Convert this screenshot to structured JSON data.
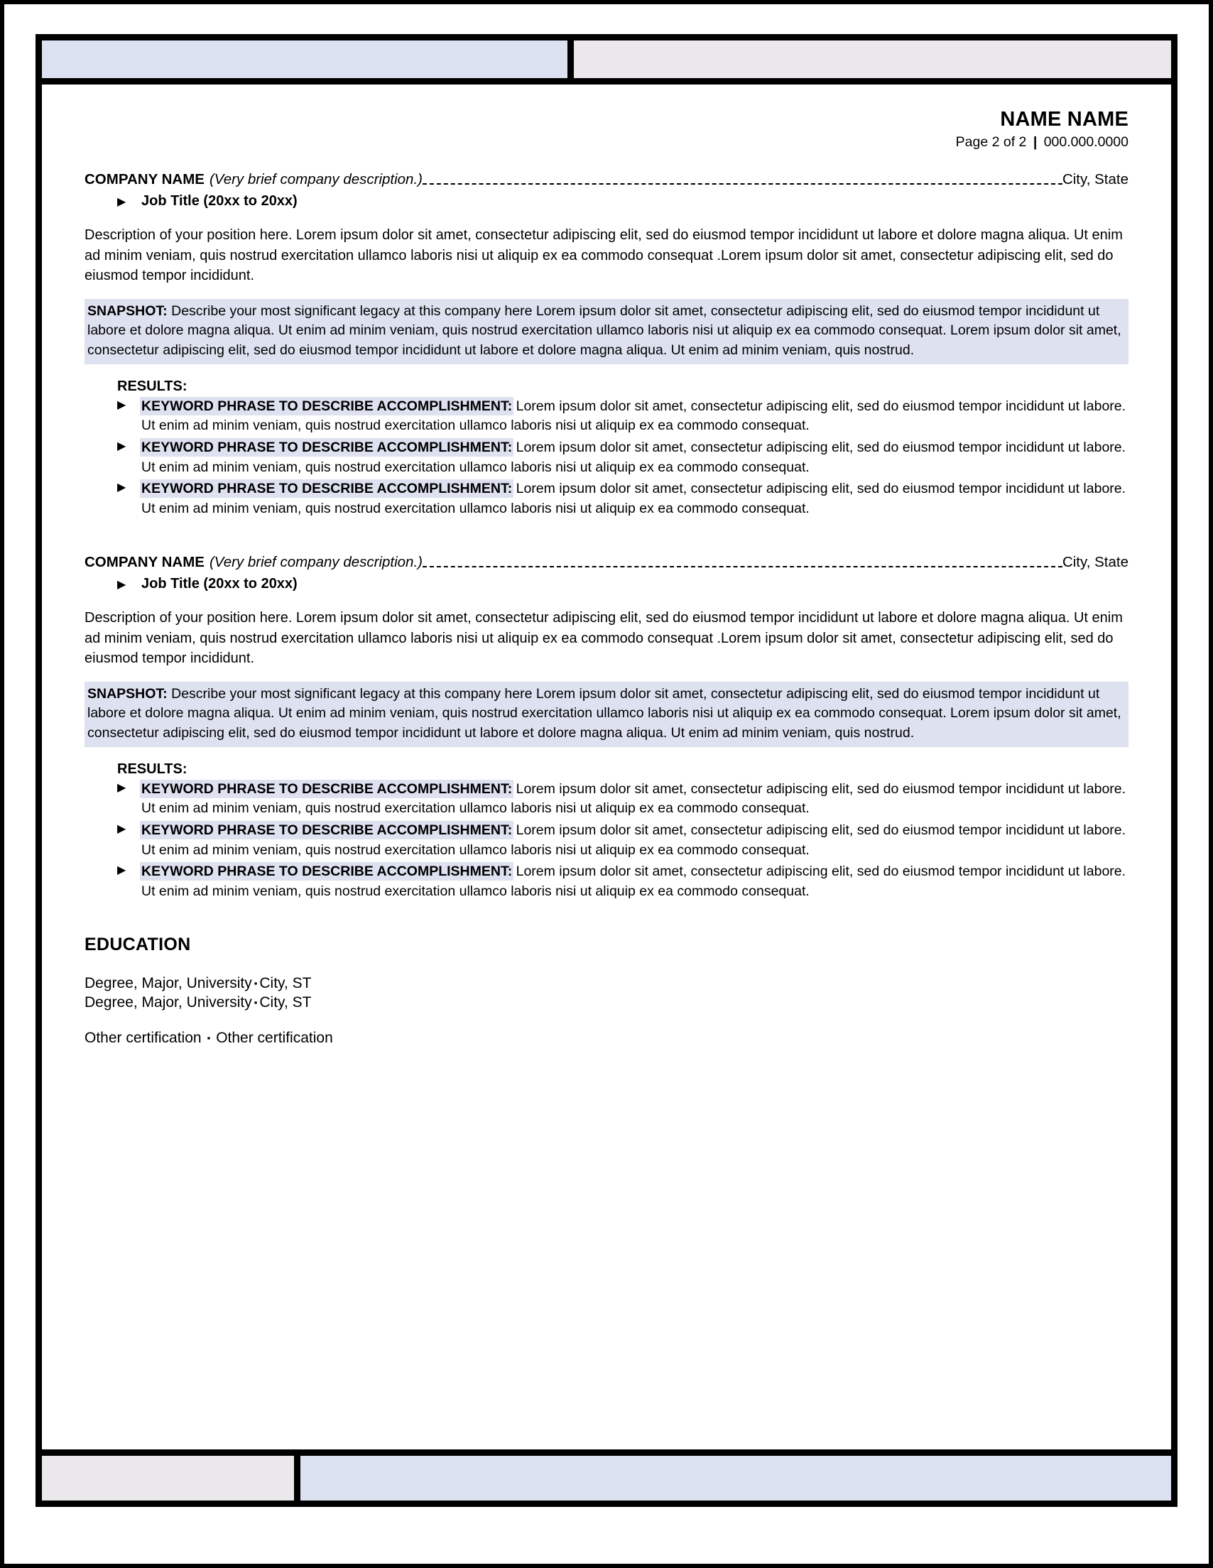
{
  "document": {
    "type": "resume-template-page",
    "colors": {
      "highlight": "#dde1f0",
      "bar_blue": "#dbe1f0",
      "bar_gray": "#eae8eb",
      "text": "#000000",
      "frame": "#000000"
    }
  },
  "header": {
    "candidate_name": "NAME NAME",
    "page_indicator": "Page 2 of 2",
    "separator": "|",
    "phone": "000.000.0000"
  },
  "glyphs": {
    "triangle_bullet": "▶",
    "square_bullet": "▪"
  },
  "experience": [
    {
      "company_name": "COMPANY NAME",
      "company_description": "(Very brief company description.)",
      "location": "City, State",
      "job_title": "Job Title (20xx to 20xx)",
      "description": "Description of your position here. Lorem ipsum dolor sit amet, consectetur adipiscing elit, sed do eiusmod tempor incididunt ut labore et dolore magna aliqua. Ut enim ad minim veniam, quis nostrud exercitation ullamco laboris nisi ut aliquip ex ea commodo consequat .Lorem ipsum dolor sit amet, consectetur adipiscing elit, sed do eiusmod tempor incididunt.",
      "snapshot_label": "SNAPSHOT:",
      "snapshot_text": " Describe your most significant legacy at this company here Lorem ipsum dolor sit amet, consectetur adipiscing elit, sed do eiusmod tempor incididunt ut labore et dolore magna aliqua. Ut enim ad minim veniam, quis nostrud exercitation ullamco laboris nisi ut aliquip ex ea commodo consequat.  Lorem ipsum dolor sit amet, consectetur adipiscing elit, sed do eiusmod tempor incididunt ut labore et dolore magna aliqua. Ut enim ad minim veniam, quis nostrud.",
      "results_heading": "RESULTS:",
      "results": [
        {
          "keyword": "KEYWORD PHRASE TO DESCRIBE ACCOMPLISHMENT:",
          "text": " Lorem ipsum dolor sit amet, consectetur adipiscing elit, sed do eiusmod tempor incididunt ut labore. Ut enim ad minim veniam, quis nostrud exercitation ullamco laboris nisi ut aliquip ex ea commodo consequat."
        },
        {
          "keyword": "KEYWORD PHRASE TO DESCRIBE ACCOMPLISHMENT:",
          "text": " Lorem ipsum dolor sit amet, consectetur adipiscing elit, sed do eiusmod tempor incididunt ut labore. Ut enim ad minim veniam, quis nostrud exercitation ullamco laboris nisi ut aliquip ex ea commodo consequat."
        },
        {
          "keyword": "KEYWORD PHRASE TO DESCRIBE ACCOMPLISHMENT:",
          "text": " Lorem ipsum dolor sit amet, consectetur adipiscing elit, sed do eiusmod tempor incididunt ut labore. Ut enim ad minim veniam, quis nostrud exercitation ullamco laboris nisi ut aliquip ex ea commodo consequat."
        }
      ]
    },
    {
      "company_name": "COMPANY NAME",
      "company_description": "(Very brief company description.)",
      "location": "City, State",
      "job_title": "Job Title (20xx to 20xx)",
      "description": "Description of your position here. Lorem ipsum dolor sit amet, consectetur adipiscing elit, sed do eiusmod tempor incididunt ut labore et dolore magna aliqua. Ut enim ad minim veniam, quis nostrud exercitation ullamco laboris nisi ut aliquip ex ea commodo consequat .Lorem ipsum dolor sit amet, consectetur adipiscing elit, sed do eiusmod tempor incididunt.",
      "snapshot_label": "SNAPSHOT:",
      "snapshot_text": " Describe your most significant legacy at this company here Lorem ipsum dolor sit amet, consectetur adipiscing elit, sed do eiusmod tempor incididunt ut labore et dolore magna aliqua. Ut enim ad minim veniam, quis nostrud exercitation ullamco laboris nisi ut aliquip ex ea commodo consequat.  Lorem ipsum dolor sit amet, consectetur adipiscing elit, sed do eiusmod tempor incididunt ut labore et dolore magna aliqua. Ut enim ad minim veniam, quis nostrud.",
      "results_heading": "RESULTS:",
      "results": [
        {
          "keyword": "KEYWORD PHRASE TO DESCRIBE ACCOMPLISHMENT:",
          "text": " Lorem ipsum dolor sit amet, consectetur adipiscing elit, sed do eiusmod tempor incididunt ut labore. Ut enim ad minim veniam, quis nostrud exercitation ullamco laboris nisi ut aliquip ex ea commodo consequat."
        },
        {
          "keyword": "KEYWORD PHRASE TO DESCRIBE ACCOMPLISHMENT:",
          "text": " Lorem ipsum dolor sit amet, consectetur adipiscing elit, sed do eiusmod tempor incididunt ut labore. Ut enim ad minim veniam, quis nostrud exercitation ullamco laboris nisi ut aliquip ex ea commodo consequat."
        },
        {
          "keyword": "KEYWORD PHRASE TO DESCRIBE ACCOMPLISHMENT:",
          "text": " Lorem ipsum dolor sit amet, consectetur adipiscing elit, sed do eiusmod tempor incididunt ut labore. Ut enim ad minim veniam, quis nostrud exercitation ullamco laboris nisi ut aliquip ex ea commodo consequat."
        }
      ]
    }
  ],
  "education": {
    "section_title": "EDUCATION",
    "entries": [
      {
        "degree": "Degree, Major, University",
        "location": "City, ST"
      },
      {
        "degree": "Degree, Major, University",
        "location": "City, ST"
      }
    ],
    "certifications": [
      "Other certification",
      "Other certification"
    ]
  }
}
